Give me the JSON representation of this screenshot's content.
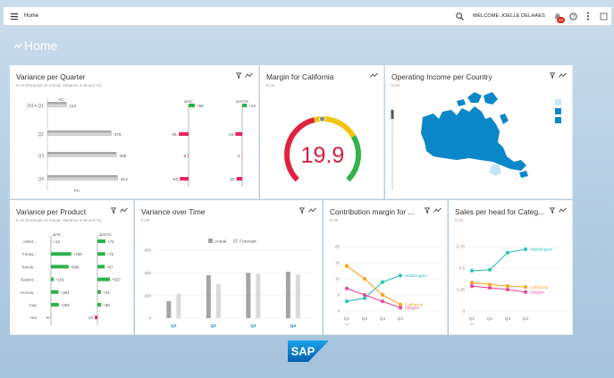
{
  "topbar": {
    "app_title": "Home",
    "welcome": "WELCOME JOELLE DELHAES",
    "notification_count": "24"
  },
  "page": {
    "title": "Home"
  },
  "colors": {
    "accent": "#0a87c9",
    "negative": "#e8265b",
    "positive": "#2cb34a",
    "gauge_text": "#d81c3f"
  },
  "cards": {
    "variance_quarter": {
      "title": "Variance per Quarter",
      "subtitle": "In M (Forecast vs Actual, Variance in M and %)",
      "chart_data": {
        "type": "bar",
        "categories": [
          "2014 Q1",
          "Q2",
          "Q3",
          "Q4"
        ],
        "series": [
          {
            "name": "AC",
            "values": [
              113,
              376,
              406,
              413
            ]
          },
          {
            "name": "FC",
            "values": [
              113,
              376,
              406,
              413
            ]
          }
        ],
        "value_labels": [
          "113",
          "376",
          "406",
          "413"
        ],
        "delta_ac": {
          "label": "ΔAC",
          "values": [
            58,
            -91,
            -5,
            -82
          ],
          "labels": [
            "+58",
            "-91",
            "-5",
            "-82"
          ]
        },
        "delta_ac_pct": {
          "label": "ΔAC%",
          "values": [
            16,
            -24,
            -1,
            -20
          ],
          "labels": [
            "+16",
            "-24",
            "-1",
            "-20"
          ]
        }
      }
    },
    "margin_california": {
      "title": "Margin for California",
      "subtitle": "In %",
      "chart_data": {
        "type": "gauge",
        "value": 19.9,
        "value_label": "19.9",
        "min": 0,
        "max": 40
      }
    },
    "operating_income": {
      "title": "Operating Income per Country",
      "subtitle": "In M",
      "chart_data": {
        "type": "map",
        "region": "Canada",
        "fill": "#0a87c9",
        "slider_level": 0.15
      }
    },
    "variance_product": {
      "title": "Variance per Product",
      "subtitle": "In M (Forecast vs Actual, Variance in M and %)",
      "chart_data": {
        "type": "bar",
        "categories": [
          "Athlet...",
          "Footw...",
          "Tennis...",
          "Basket...",
          "Access...",
          "Cap",
          "Hat"
        ],
        "delta_ac": {
          "label": "ΔAC",
          "values": [
            13,
            759,
            658,
            101,
            284,
            292,
            -8
          ],
          "labels": [
            "+13",
            "+759",
            "+658",
            "+101",
            "+284",
            "+292",
            "-8"
          ]
        },
        "delta_ac_pct": {
          "label": "ΔAC%",
          "values": [
            74,
            72,
            67,
            537,
            33,
            35,
            -24
          ],
          "labels": [
            "+74",
            "+72",
            "+67",
            "+537",
            "+33",
            "+35",
            "-24"
          ]
        }
      }
    },
    "variance_time": {
      "title": "Variance over Time",
      "subtitle": "In M",
      "chart_data": {
        "type": "bar",
        "categories": [
          "Q1",
          "Q2",
          "Q3",
          "Q4"
        ],
        "series": [
          {
            "name": "Actual",
            "values": [
              150,
              380,
              400,
              410
            ]
          },
          {
            "name": "Forecast",
            "values": [
              215,
              300,
              390,
              385
            ]
          }
        ],
        "yticks": [
          "0",
          "200",
          "400",
          "600"
        ],
        "ylim": [
          0,
          600
        ]
      }
    },
    "contribution_margin": {
      "title": "Contribution margin for ...",
      "subtitle": "In M",
      "chart_data": {
        "type": "line",
        "categories": [
          "Q1",
          "Q2",
          "Q3",
          "Q4"
        ],
        "x_sub": "'14",
        "yticks": [
          "0",
          "5",
          "10",
          "15",
          "20"
        ],
        "ylim": [
          0,
          20
        ],
        "series": [
          {
            "name": "Washington",
            "values": [
              3,
              4,
              9,
              11
            ],
            "color": "#2ec4b6"
          },
          {
            "name": "California",
            "values": [
              14,
              10,
              5,
              2
            ],
            "color": "#f5a623"
          },
          {
            "name": "Oregon",
            "values": [
              7,
              5,
              3,
              1
            ],
            "color": "#e64a9a"
          }
        ]
      }
    },
    "sales_head": {
      "title": "Sales per head for Categ...",
      "subtitle": "In M",
      "chart_data": {
        "type": "line",
        "categories": [
          "Q1",
          "Q2",
          "Q3",
          "Q4"
        ],
        "x_sub": "'14",
        "yticks": [
          "0",
          "0.25",
          "0.5",
          "0.75"
        ],
        "ylim": [
          0,
          0.75
        ],
        "series": [
          {
            "name": "Washington",
            "values": [
              0.47,
              0.48,
              0.68,
              0.72
            ],
            "color": "#2ec4b6"
          },
          {
            "name": "California",
            "values": [
              0.33,
              0.31,
              0.29,
              0.28
            ],
            "color": "#f5a623"
          },
          {
            "name": "Oregon",
            "values": [
              0.29,
              0.27,
              0.25,
              0.22
            ],
            "color": "#e64a9a"
          }
        ]
      }
    }
  },
  "footer": {
    "logo_text": "SAP"
  }
}
